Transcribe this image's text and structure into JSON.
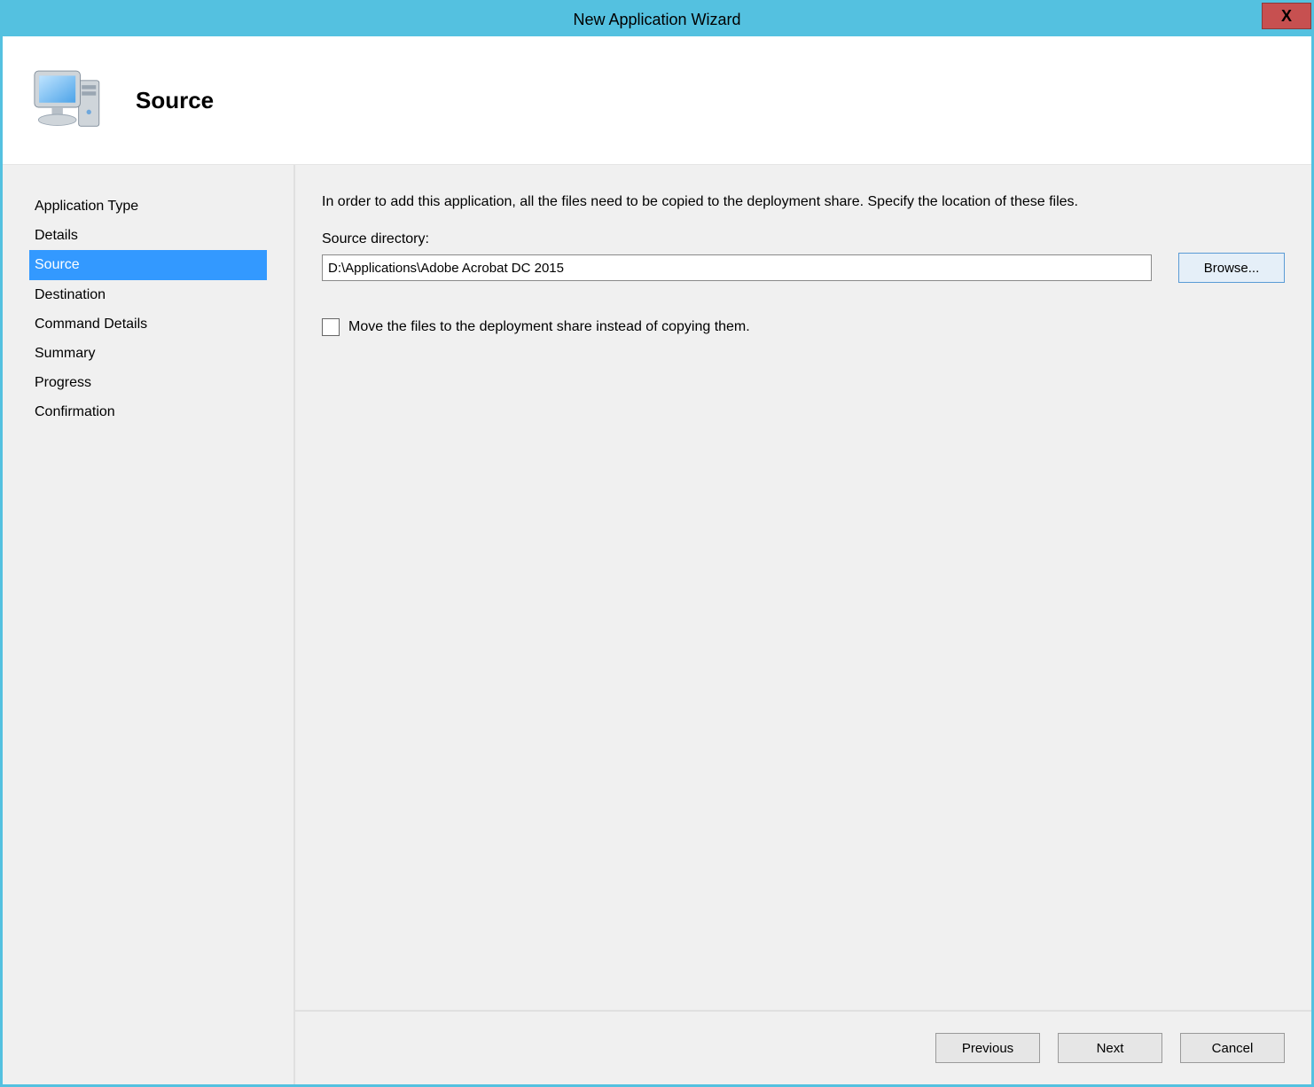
{
  "window": {
    "title": "New Application Wizard",
    "close_label": "X"
  },
  "header": {
    "title": "Source"
  },
  "sidebar": {
    "items": [
      {
        "label": "Application Type",
        "selected": false
      },
      {
        "label": "Details",
        "selected": false
      },
      {
        "label": "Source",
        "selected": true
      },
      {
        "label": "Destination",
        "selected": false
      },
      {
        "label": "Command Details",
        "selected": false
      },
      {
        "label": "Summary",
        "selected": false
      },
      {
        "label": "Progress",
        "selected": false
      },
      {
        "label": "Confirmation",
        "selected": false
      }
    ]
  },
  "main": {
    "description": "In order to add this application, all the files need to be copied to the deployment share.  Specify the location of these files.",
    "source_directory_label": "Source directory:",
    "source_directory_value": "D:\\Applications\\Adobe Acrobat DC 2015",
    "browse_label": "Browse...",
    "move_checkbox_label": "Move the files to the deployment share instead of copying them.",
    "move_checkbox_checked": false
  },
  "footer": {
    "previous": "Previous",
    "next": "Next",
    "cancel": "Cancel"
  }
}
